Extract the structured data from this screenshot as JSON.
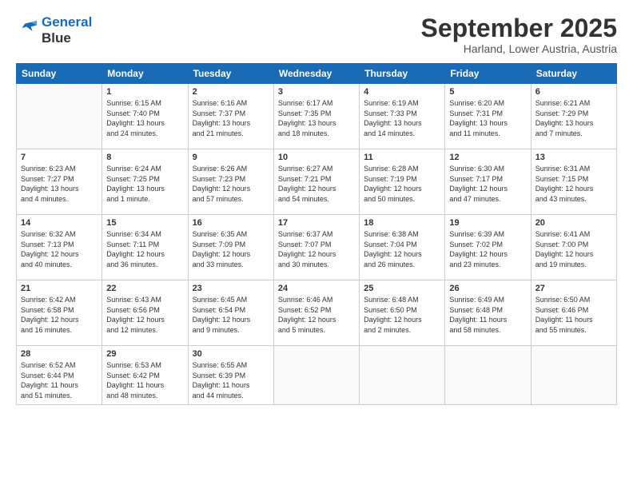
{
  "logo": {
    "line1": "General",
    "line2": "Blue"
  },
  "title": "September 2025",
  "subtitle": "Harland, Lower Austria, Austria",
  "weekdays": [
    "Sunday",
    "Monday",
    "Tuesday",
    "Wednesday",
    "Thursday",
    "Friday",
    "Saturday"
  ],
  "weeks": [
    [
      {
        "day": "",
        "info": ""
      },
      {
        "day": "1",
        "info": "Sunrise: 6:15 AM\nSunset: 7:40 PM\nDaylight: 13 hours\nand 24 minutes."
      },
      {
        "day": "2",
        "info": "Sunrise: 6:16 AM\nSunset: 7:37 PM\nDaylight: 13 hours\nand 21 minutes."
      },
      {
        "day": "3",
        "info": "Sunrise: 6:17 AM\nSunset: 7:35 PM\nDaylight: 13 hours\nand 18 minutes."
      },
      {
        "day": "4",
        "info": "Sunrise: 6:19 AM\nSunset: 7:33 PM\nDaylight: 13 hours\nand 14 minutes."
      },
      {
        "day": "5",
        "info": "Sunrise: 6:20 AM\nSunset: 7:31 PM\nDaylight: 13 hours\nand 11 minutes."
      },
      {
        "day": "6",
        "info": "Sunrise: 6:21 AM\nSunset: 7:29 PM\nDaylight: 13 hours\nand 7 minutes."
      }
    ],
    [
      {
        "day": "7",
        "info": "Sunrise: 6:23 AM\nSunset: 7:27 PM\nDaylight: 13 hours\nand 4 minutes."
      },
      {
        "day": "8",
        "info": "Sunrise: 6:24 AM\nSunset: 7:25 PM\nDaylight: 13 hours\nand 1 minute."
      },
      {
        "day": "9",
        "info": "Sunrise: 6:26 AM\nSunset: 7:23 PM\nDaylight: 12 hours\nand 57 minutes."
      },
      {
        "day": "10",
        "info": "Sunrise: 6:27 AM\nSunset: 7:21 PM\nDaylight: 12 hours\nand 54 minutes."
      },
      {
        "day": "11",
        "info": "Sunrise: 6:28 AM\nSunset: 7:19 PM\nDaylight: 12 hours\nand 50 minutes."
      },
      {
        "day": "12",
        "info": "Sunrise: 6:30 AM\nSunset: 7:17 PM\nDaylight: 12 hours\nand 47 minutes."
      },
      {
        "day": "13",
        "info": "Sunrise: 6:31 AM\nSunset: 7:15 PM\nDaylight: 12 hours\nand 43 minutes."
      }
    ],
    [
      {
        "day": "14",
        "info": "Sunrise: 6:32 AM\nSunset: 7:13 PM\nDaylight: 12 hours\nand 40 minutes."
      },
      {
        "day": "15",
        "info": "Sunrise: 6:34 AM\nSunset: 7:11 PM\nDaylight: 12 hours\nand 36 minutes."
      },
      {
        "day": "16",
        "info": "Sunrise: 6:35 AM\nSunset: 7:09 PM\nDaylight: 12 hours\nand 33 minutes."
      },
      {
        "day": "17",
        "info": "Sunrise: 6:37 AM\nSunset: 7:07 PM\nDaylight: 12 hours\nand 30 minutes."
      },
      {
        "day": "18",
        "info": "Sunrise: 6:38 AM\nSunset: 7:04 PM\nDaylight: 12 hours\nand 26 minutes."
      },
      {
        "day": "19",
        "info": "Sunrise: 6:39 AM\nSunset: 7:02 PM\nDaylight: 12 hours\nand 23 minutes."
      },
      {
        "day": "20",
        "info": "Sunrise: 6:41 AM\nSunset: 7:00 PM\nDaylight: 12 hours\nand 19 minutes."
      }
    ],
    [
      {
        "day": "21",
        "info": "Sunrise: 6:42 AM\nSunset: 6:58 PM\nDaylight: 12 hours\nand 16 minutes."
      },
      {
        "day": "22",
        "info": "Sunrise: 6:43 AM\nSunset: 6:56 PM\nDaylight: 12 hours\nand 12 minutes."
      },
      {
        "day": "23",
        "info": "Sunrise: 6:45 AM\nSunset: 6:54 PM\nDaylight: 12 hours\nand 9 minutes."
      },
      {
        "day": "24",
        "info": "Sunrise: 6:46 AM\nSunset: 6:52 PM\nDaylight: 12 hours\nand 5 minutes."
      },
      {
        "day": "25",
        "info": "Sunrise: 6:48 AM\nSunset: 6:50 PM\nDaylight: 12 hours\nand 2 minutes."
      },
      {
        "day": "26",
        "info": "Sunrise: 6:49 AM\nSunset: 6:48 PM\nDaylight: 11 hours\nand 58 minutes."
      },
      {
        "day": "27",
        "info": "Sunrise: 6:50 AM\nSunset: 6:46 PM\nDaylight: 11 hours\nand 55 minutes."
      }
    ],
    [
      {
        "day": "28",
        "info": "Sunrise: 6:52 AM\nSunset: 6:44 PM\nDaylight: 11 hours\nand 51 minutes."
      },
      {
        "day": "29",
        "info": "Sunrise: 6:53 AM\nSunset: 6:42 PM\nDaylight: 11 hours\nand 48 minutes."
      },
      {
        "day": "30",
        "info": "Sunrise: 6:55 AM\nSunset: 6:39 PM\nDaylight: 11 hours\nand 44 minutes."
      },
      {
        "day": "",
        "info": ""
      },
      {
        "day": "",
        "info": ""
      },
      {
        "day": "",
        "info": ""
      },
      {
        "day": "",
        "info": ""
      }
    ]
  ]
}
